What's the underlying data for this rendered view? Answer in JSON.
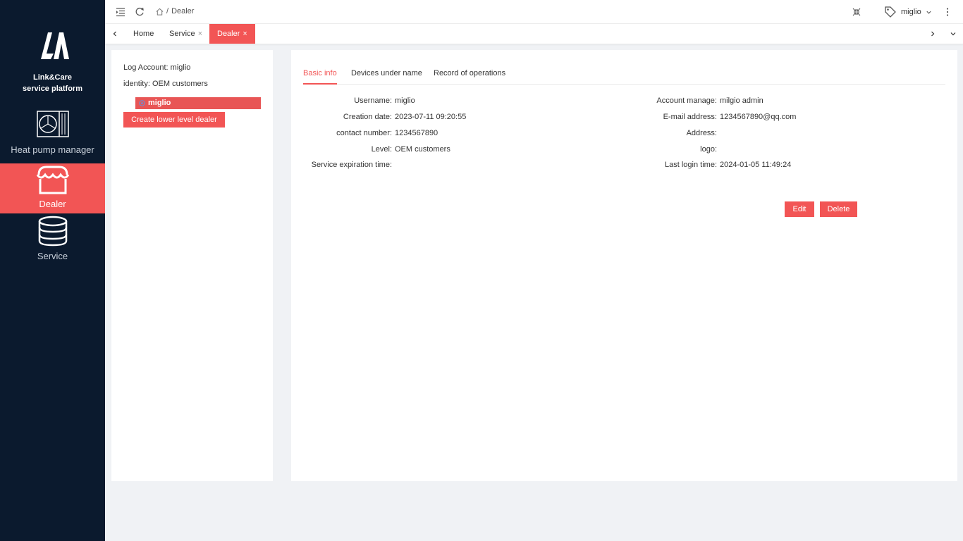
{
  "sidebar": {
    "brand_line1": "Link&Care",
    "brand_line2": "service platform",
    "items": [
      {
        "label": "Heat pump manager",
        "icon": "heat-pump-icon"
      },
      {
        "label": "Dealer",
        "icon": "store-icon",
        "active": true
      },
      {
        "label": "Service",
        "icon": "database-icon"
      }
    ]
  },
  "topbar": {
    "breadcrumb_sep": "/",
    "breadcrumb_current": "Dealer",
    "username": "miglio"
  },
  "tabs": [
    {
      "label": "Home",
      "closable": false
    },
    {
      "label": "Service",
      "closable": true
    },
    {
      "label": "Dealer",
      "closable": true,
      "active": true
    }
  ],
  "left_panel": {
    "log_account_label": "Log Account:",
    "log_account_value": "miglio",
    "identity_label": "identity:",
    "identity_value": "OEM customers",
    "tree_node": "miglio",
    "create_button": "Create lower level dealer"
  },
  "detail": {
    "tabs": [
      "Basic info",
      "Devices under name",
      "Record of operations"
    ],
    "left_fields": [
      {
        "label": "Username:",
        "value": "miglio"
      },
      {
        "label": "Creation date:",
        "value": "2023-07-11 09:20:55"
      },
      {
        "label": "contact number:",
        "value": "1234567890"
      },
      {
        "label": "Level:",
        "value": "OEM customers"
      },
      {
        "label": "Service expiration time:",
        "value": ""
      }
    ],
    "right_fields": [
      {
        "label": "Account manage:",
        "value": "milgio admin"
      },
      {
        "label": "E-mail address:",
        "value": "1234567890@qq.com"
      },
      {
        "label": "Address:",
        "value": ""
      },
      {
        "label": "logo:",
        "value": ""
      },
      {
        "label": "Last login time:",
        "value": "2024-01-05 11:49:24"
      }
    ],
    "edit_button": "Edit",
    "delete_button": "Delete"
  },
  "colors": {
    "accent": "#f25555",
    "sidebar_bg": "#0b1a2e"
  }
}
